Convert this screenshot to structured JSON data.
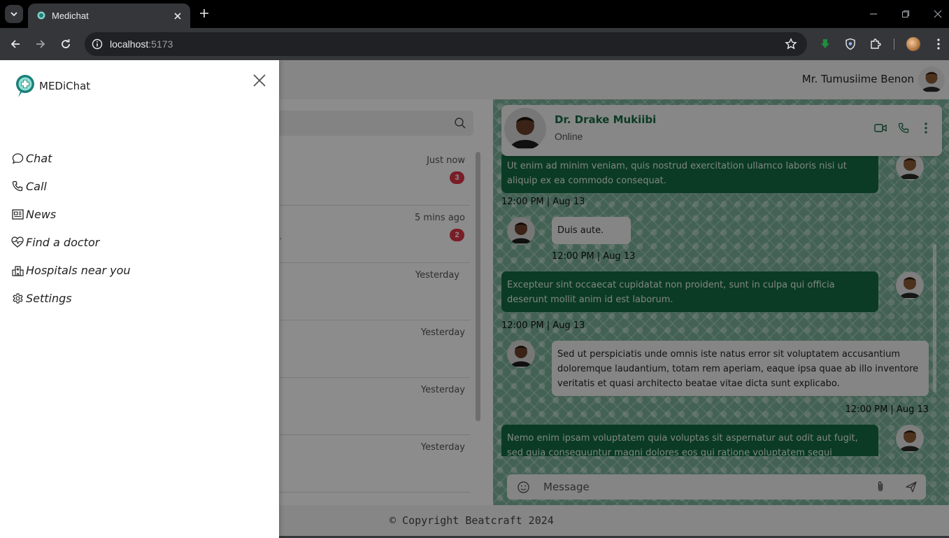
{
  "browser": {
    "tab_title": "Medichat",
    "url_host": "localhost",
    "url_port": ":5173"
  },
  "header": {
    "user_name": "Mr. Tumusiime Benon"
  },
  "chat_list": {
    "conversations": [
      {
        "time": "Just now",
        "badge": "3",
        "preview": ""
      },
      {
        "time": "5 mins ago",
        "badge": "2",
        "preview": "e."
      },
      {
        "time": "Yesterday",
        "badge": "",
        "preview": ""
      },
      {
        "time": "Yesterday",
        "badge": "",
        "preview": ""
      },
      {
        "time": "Yesterday",
        "badge": "",
        "preview": ""
      },
      {
        "time": "Yesterday",
        "badge": "",
        "preview": ""
      }
    ]
  },
  "chat": {
    "contact_name": "Dr. Drake Mukiibi",
    "contact_status": "Online",
    "messages": [
      {
        "type": "sent",
        "text": "Ut enim ad minim veniam, quis nostrud exercitation ullamco laboris nisi ut aliquip ex ea commodo consequat.",
        "time": "12:00 PM | Aug 13"
      },
      {
        "type": "recv",
        "text": "Duis aute.",
        "time": "12:00 PM | Aug 13"
      },
      {
        "type": "sent",
        "text": "Excepteur sint occaecat cupidatat non proident, sunt in culpa qui officia deserunt mollit anim id est laborum.",
        "time": "12:00 PM | Aug 13"
      },
      {
        "type": "recv",
        "text": "Sed ut perspiciatis unde omnis iste natus error sit voluptatem accusantium doloremque laudantium, totam rem aperiam, eaque ipsa quae ab illo inventore veritatis et quasi architecto beatae vitae dicta sunt explicabo.",
        "time": "12:00 PM | Aug 13"
      },
      {
        "type": "sent",
        "text": "Nemo enim ipsam voluptatem quia voluptas sit aspernatur aut odit aut fugit, sed quia consequuntur magni dolores eos qui ratione voluptatem sequi nesciunt.",
        "time": ""
      }
    ],
    "composer_placeholder": "Message"
  },
  "footer": {
    "text": "© Copyright Beatcraft 2024"
  },
  "drawer": {
    "brand": "MEDiChat",
    "nav": [
      {
        "label": "Chat",
        "icon": "chat-bubble-icon"
      },
      {
        "label": "Call",
        "icon": "phone-icon"
      },
      {
        "label": "News",
        "icon": "newspaper-icon"
      },
      {
        "label": "Find a doctor",
        "icon": "heart-pulse-icon"
      },
      {
        "label": "Hospitals near you",
        "icon": "hospital-icon"
      },
      {
        "label": "Settings",
        "icon": "gear-icon"
      }
    ]
  },
  "colors": {
    "brand_green": "#146c43",
    "badge_red": "#dc3545",
    "pattern_green": "#7ab39b"
  }
}
